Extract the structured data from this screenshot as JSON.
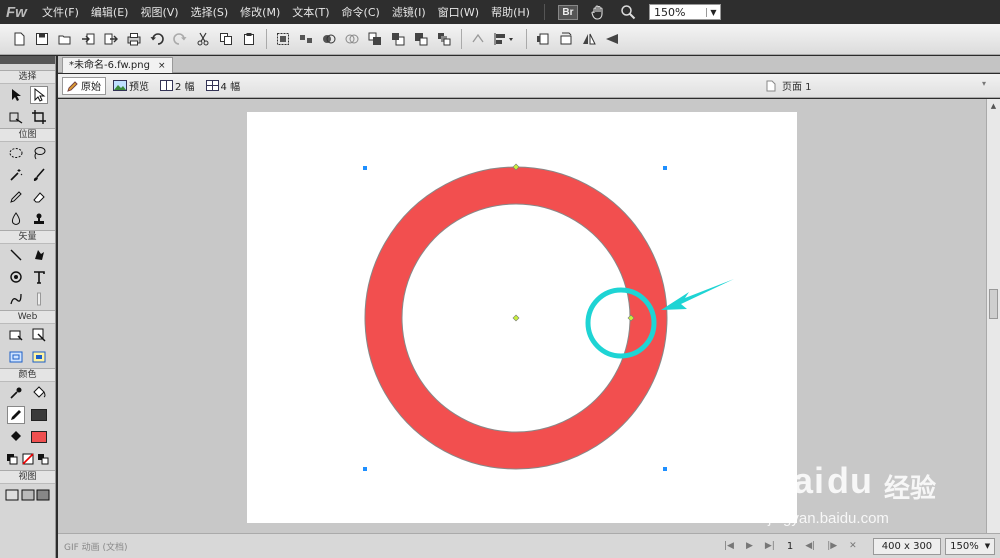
{
  "app": {
    "logo": "Fw"
  },
  "menu": [
    "文件(F)",
    "编辑(E)",
    "视图(V)",
    "选择(S)",
    "修改(M)",
    "文本(T)",
    "命令(C)",
    "滤镜(I)",
    "窗口(W)",
    "帮助(H)"
  ],
  "menubar_tools": {
    "bridge_badge": "Br",
    "hand_icon": "hand-icon",
    "zoom_icon": "magnifier-icon",
    "zoom_value": "150%"
  },
  "toolbar_icons": [
    "new-icon",
    "save-icon",
    "open-icon",
    "import-icon",
    "export-icon",
    "print-icon",
    "undo-icon",
    "redo-icon",
    "cut-icon",
    "copy-icon",
    "paste-icon",
    "group-icon",
    "ungroup-icon",
    "join-icon",
    "split-icon",
    "bring-front-icon",
    "bring-forward-icon",
    "send-backward-icon",
    "send-back-icon",
    "rotate-icon",
    "align-icon",
    "rotate-left-icon",
    "rotate-right-icon",
    "flip-horizontal-icon",
    "flip-vertical-icon"
  ],
  "tools_panel": {
    "sections": {
      "select": "选择",
      "bitmap": "位图",
      "vector": "矢量",
      "web": "Web",
      "colors": "颜色",
      "view": "视图"
    },
    "colors": {
      "stroke": "#3a3a3a",
      "fill": "#ef4f4f"
    }
  },
  "document": {
    "tab_title": "*未命名-6.fw.png",
    "close_label": "×"
  },
  "viewbar": {
    "original": "原始",
    "preview": "预览",
    "two_up": "2 幅",
    "four_up": "4 幅",
    "page": "页面 1"
  },
  "canvas": {
    "ring_color": "#f24f4f",
    "annotation_color": "#1ed4d4",
    "handle_color": "#1e8fff",
    "point_color": "#c8f03c"
  },
  "status": {
    "doc_info": "GIF 动画 (文档)",
    "frame": "1",
    "dimensions": "400 x 300",
    "zoom": "150%"
  },
  "watermark": {
    "brand": "Bai",
    "brand_tail": "du",
    "brand_cn": "经验",
    "url": "jingyan.baidu.com"
  }
}
